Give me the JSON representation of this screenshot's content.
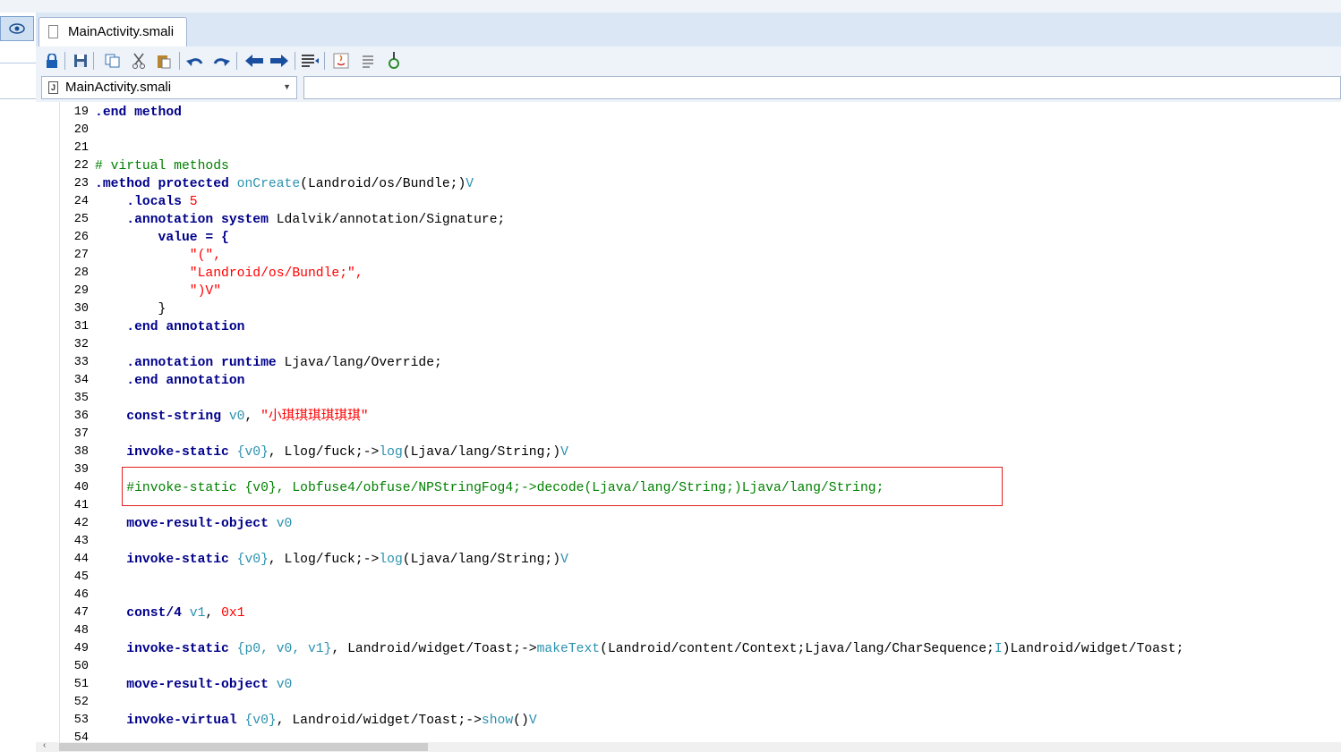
{
  "tab": {
    "label": "MainActivity.smali"
  },
  "toolbar": {
    "icons": [
      "lock-icon",
      "save-icon",
      "copy-icon",
      "cut-icon",
      "paste-icon",
      "undo-icon",
      "redo-icon",
      "back-arrow-icon",
      "forward-arrow-icon",
      "indent-icon",
      "java-icon",
      "list-icon",
      "run-icon"
    ]
  },
  "file_selector": {
    "value": "MainActivity.smali",
    "icon": "J"
  },
  "search": {
    "placeholder": ""
  },
  "editor": {
    "lines": [
      {
        "n": "19",
        "tokens": [
          {
            "t": ".end method",
            "cls": "k"
          }
        ]
      },
      {
        "n": "20",
        "tokens": []
      },
      {
        "n": "21",
        "tokens": []
      },
      {
        "n": "22",
        "tokens": [
          {
            "t": "# virtual methods",
            "cls": "c"
          }
        ]
      },
      {
        "n": "23",
        "tokens": [
          {
            "t": ".method protected ",
            "cls": "k"
          },
          {
            "t": "onCreate",
            "cls": "m"
          },
          {
            "t": "(Landroid/os/Bundle;)",
            "cls": "p"
          },
          {
            "t": "V",
            "cls": "m"
          }
        ]
      },
      {
        "n": "24",
        "tokens": [
          {
            "t": "    .locals ",
            "cls": "k"
          },
          {
            "t": "5",
            "cls": "s"
          }
        ]
      },
      {
        "n": "25",
        "tokens": [
          {
            "t": "    .annotation system ",
            "cls": "k"
          },
          {
            "t": "Ldalvik/annotation/Signature;",
            "cls": "p"
          }
        ]
      },
      {
        "n": "26",
        "tokens": [
          {
            "t": "        value = {",
            "cls": "k"
          }
        ]
      },
      {
        "n": "27",
        "tokens": [
          {
            "t": "            \"(\",",
            "cls": "s"
          }
        ]
      },
      {
        "n": "28",
        "tokens": [
          {
            "t": "            \"Landroid/os/Bundle;\",",
            "cls": "s"
          }
        ]
      },
      {
        "n": "29",
        "tokens": [
          {
            "t": "            \")V\"",
            "cls": "s"
          }
        ]
      },
      {
        "n": "30",
        "tokens": [
          {
            "t": "        }",
            "cls": "p"
          }
        ]
      },
      {
        "n": "31",
        "tokens": [
          {
            "t": "    .end annotation",
            "cls": "k"
          }
        ]
      },
      {
        "n": "32",
        "tokens": []
      },
      {
        "n": "33",
        "tokens": [
          {
            "t": "    .annotation runtime ",
            "cls": "k"
          },
          {
            "t": "Ljava/lang/Override;",
            "cls": "p"
          }
        ]
      },
      {
        "n": "34",
        "tokens": [
          {
            "t": "    .end annotation",
            "cls": "k"
          }
        ]
      },
      {
        "n": "35",
        "tokens": []
      },
      {
        "n": "36",
        "tokens": [
          {
            "t": "    const-string ",
            "cls": "k"
          },
          {
            "t": "v0",
            "cls": "regs"
          },
          {
            "t": ", ",
            "cls": "p"
          },
          {
            "t": "\"小琪琪琪琪琪琪\"",
            "cls": "s"
          }
        ]
      },
      {
        "n": "37",
        "tokens": []
      },
      {
        "n": "38",
        "tokens": [
          {
            "t": "    invoke-static ",
            "cls": "k"
          },
          {
            "t": "{v0}",
            "cls": "regs"
          },
          {
            "t": ", Llog/fuck;->",
            "cls": "p"
          },
          {
            "t": "log",
            "cls": "m"
          },
          {
            "t": "(Ljava/lang/String;)",
            "cls": "p"
          },
          {
            "t": "V",
            "cls": "m"
          }
        ]
      },
      {
        "n": "39",
        "tokens": []
      },
      {
        "n": "40",
        "tokens": [
          {
            "t": "    #invoke-static {v0}, Lobfuse4/obfuse/NPStringFog4;->decode(Ljava/lang/String;)Ljava/lang/String;",
            "cls": "c"
          }
        ]
      },
      {
        "n": "41",
        "tokens": []
      },
      {
        "n": "42",
        "tokens": [
          {
            "t": "    move-result-object ",
            "cls": "k"
          },
          {
            "t": "v0",
            "cls": "regs"
          }
        ]
      },
      {
        "n": "43",
        "tokens": []
      },
      {
        "n": "44",
        "tokens": [
          {
            "t": "    invoke-static ",
            "cls": "k"
          },
          {
            "t": "{v0}",
            "cls": "regs"
          },
          {
            "t": ", Llog/fuck;->",
            "cls": "p"
          },
          {
            "t": "log",
            "cls": "m"
          },
          {
            "t": "(Ljava/lang/String;)",
            "cls": "p"
          },
          {
            "t": "V",
            "cls": "m"
          }
        ]
      },
      {
        "n": "45",
        "tokens": []
      },
      {
        "n": "46",
        "tokens": []
      },
      {
        "n": "47",
        "tokens": [
          {
            "t": "    const/4 ",
            "cls": "k"
          },
          {
            "t": "v1",
            "cls": "regs"
          },
          {
            "t": ", ",
            "cls": "p"
          },
          {
            "t": "0x1",
            "cls": "s"
          }
        ]
      },
      {
        "n": "48",
        "tokens": []
      },
      {
        "n": "49",
        "tokens": [
          {
            "t": "    invoke-static ",
            "cls": "k"
          },
          {
            "t": "{p0, v0, v1}",
            "cls": "regs"
          },
          {
            "t": ", Landroid/widget/Toast;->",
            "cls": "p"
          },
          {
            "t": "makeText",
            "cls": "m"
          },
          {
            "t": "(Landroid/content/Context;Ljava/lang/CharSequence;",
            "cls": "p"
          },
          {
            "t": "I",
            "cls": "m"
          },
          {
            "t": ")Landroid/widget/Toast;",
            "cls": "p"
          }
        ]
      },
      {
        "n": "50",
        "tokens": []
      },
      {
        "n": "51",
        "tokens": [
          {
            "t": "    move-result-object ",
            "cls": "k"
          },
          {
            "t": "v0",
            "cls": "regs"
          }
        ]
      },
      {
        "n": "52",
        "tokens": []
      },
      {
        "n": "53",
        "tokens": [
          {
            "t": "    invoke-virtual ",
            "cls": "k"
          },
          {
            "t": "{v0}",
            "cls": "regs"
          },
          {
            "t": ", Landroid/widget/Toast;->",
            "cls": "p"
          },
          {
            "t": "show",
            "cls": "m"
          },
          {
            "t": "()",
            "cls": "p"
          },
          {
            "t": "V",
            "cls": "m"
          }
        ]
      },
      {
        "n": "54",
        "tokens": []
      }
    ]
  }
}
